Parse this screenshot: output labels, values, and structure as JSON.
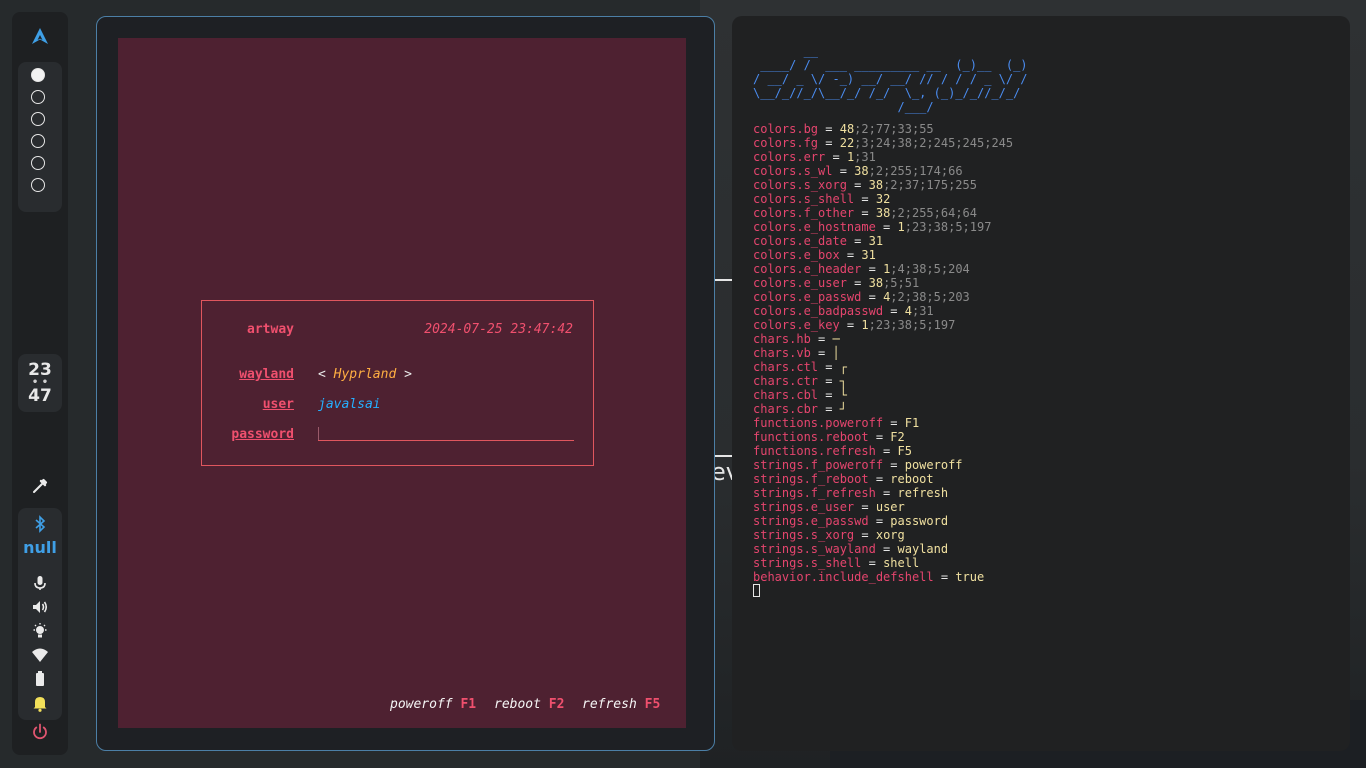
{
  "bar": {
    "clock": {
      "hour": "23",
      "separator": "• •",
      "minute": "47"
    },
    "workspaces": [
      true,
      false,
      false,
      false,
      false,
      false
    ],
    "network_status": "null",
    "colors": {
      "accent": "#3f9fe6",
      "power": "#e05570",
      "notification": "#f2e05a"
    },
    "icons": [
      "arch-logo-icon",
      "color-picker-icon",
      "bluetooth-icon",
      "microphone-icon",
      "volume-icon",
      "brightness-icon",
      "wifi-icon",
      "battery-icon",
      "notification-bell-icon",
      "power-icon"
    ]
  },
  "greeter": {
    "hostname": "artway",
    "datetime": "2024-07-25 23:47:42",
    "session_label": "wayland",
    "session_left": "<",
    "session_value": "Hyprland",
    "session_right": ">",
    "user_label": "user",
    "user_value": "javalsai",
    "password_label": "password",
    "password_value": "",
    "footer": {
      "poweroff": "poweroff",
      "poweroff_key": "F1",
      "reboot": "reboot",
      "reboot_key": "F2",
      "refresh": "refresh",
      "refresh_key": "F5"
    },
    "colors": {
      "background": "#4e2131",
      "accent": "#f0506e",
      "session": "#ffae42",
      "user": "#25afff"
    }
  },
  "config_terminal": {
    "banner": "       __\n ____/ /  ___ _________ __  (_)__  (_)\n/ __/ _ \\/ -_) __/ __/ // / / / _ \\/ /\n\\__/_//_/\\__/_/ /_/  \\_, (_)_/_//_/_/\n                    /___/",
    "lines": [
      {
        "key": "colors.bg",
        "value": "48",
        "rest": ";2;77;33;55"
      },
      {
        "key": "colors.fg",
        "value": "22",
        "rest": ";3;24;38;2;245;245;245"
      },
      {
        "key": "colors.err",
        "value": "1",
        "rest": ";31"
      },
      {
        "key": "colors.s_wl",
        "value": "38",
        "rest": ";2;255;174;66"
      },
      {
        "key": "colors.s_xorg",
        "value": "38",
        "rest": ";2;37;175;255"
      },
      {
        "key": "colors.s_shell",
        "value": "32",
        "rest": ""
      },
      {
        "key": "colors.f_other",
        "value": "38",
        "rest": ";2;255;64;64"
      },
      {
        "key": "colors.e_hostname",
        "value": "1",
        "rest": ";23;38;5;197"
      },
      {
        "key": "colors.e_date",
        "value": "31",
        "rest": ""
      },
      {
        "key": "colors.e_box",
        "value": "31",
        "rest": ""
      },
      {
        "key": "colors.e_header",
        "value": "1",
        "rest": ";4;38;5;204"
      },
      {
        "key": "colors.e_user",
        "value": "38",
        "rest": ";5;51"
      },
      {
        "key": "colors.e_passwd",
        "value": "4",
        "rest": ";2;38;5;203"
      },
      {
        "key": "colors.e_badpasswd",
        "value": "4",
        "rest": ";31"
      },
      {
        "key": "colors.e_key",
        "value": "1",
        "rest": ";23;38;5;197"
      },
      {
        "key": "chars.hb",
        "value": "─",
        "rest": ""
      },
      {
        "key": "chars.vb",
        "value": "│",
        "rest": ""
      },
      {
        "key": "chars.ctl",
        "value": "┌",
        "rest": ""
      },
      {
        "key": "chars.ctr",
        "value": "┐",
        "rest": ""
      },
      {
        "key": "chars.cbl",
        "value": "└",
        "rest": ""
      },
      {
        "key": "chars.cbr",
        "value": "┘",
        "rest": ""
      },
      {
        "key": "functions.poweroff",
        "value": "F1",
        "rest": ""
      },
      {
        "key": "functions.reboot",
        "value": "F2",
        "rest": ""
      },
      {
        "key": "functions.refresh",
        "value": "F5",
        "rest": ""
      },
      {
        "key": "strings.f_poweroff",
        "value": "poweroff",
        "rest": ""
      },
      {
        "key": "strings.f_reboot",
        "value": "reboot",
        "rest": ""
      },
      {
        "key": "strings.f_refresh",
        "value": "refresh",
        "rest": ""
      },
      {
        "key": "strings.e_user",
        "value": "user",
        "rest": ""
      },
      {
        "key": "strings.e_passwd",
        "value": "password",
        "rest": ""
      },
      {
        "key": "strings.s_xorg",
        "value": "xorg",
        "rest": ""
      },
      {
        "key": "strings.s_wayland",
        "value": "wayland",
        "rest": ""
      },
      {
        "key": "strings.s_shell",
        "value": "shell",
        "rest": ""
      },
      {
        "key": "behavior.include_defshell",
        "value": "true",
        "rest": ""
      }
    ],
    "colors": {
      "key": "#e5456e",
      "value": "#f0e0a0",
      "dim": "#8a8a8a",
      "banner": "#4a8cf0"
    }
  },
  "background_peek": {
    "text": "ev"
  }
}
